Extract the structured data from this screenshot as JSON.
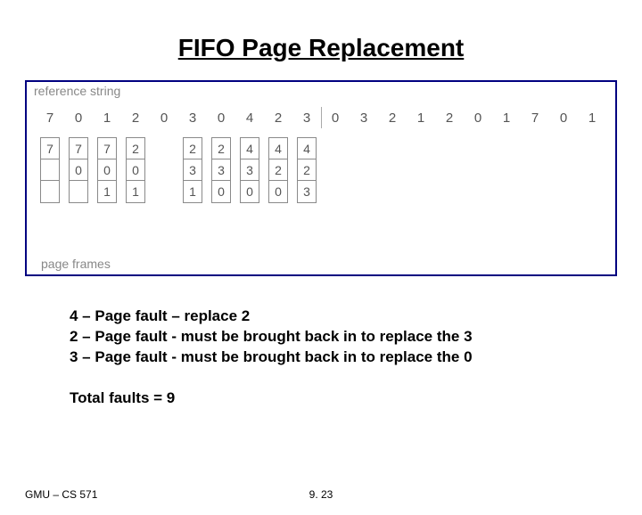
{
  "title": "FIFO Page Replacement",
  "diagram": {
    "ref_label": "reference string",
    "pf_label": "page frames",
    "reference": [
      "7",
      "0",
      "1",
      "2",
      "0",
      "3",
      "0",
      "4",
      "2",
      "3",
      "0",
      "3",
      "2",
      "1",
      "2",
      "0",
      "1",
      "7",
      "0",
      "1"
    ],
    "divider_after_index": 9,
    "frames": [
      [
        "7",
        "",
        ""
      ],
      [
        "7",
        "0",
        ""
      ],
      [
        "7",
        "0",
        "1"
      ],
      [
        "2",
        "0",
        "1"
      ],
      null,
      [
        "2",
        "3",
        "1"
      ],
      [
        "2",
        "3",
        "0"
      ],
      [
        "4",
        "3",
        "0"
      ],
      [
        "4",
        "2",
        "0"
      ],
      [
        "4",
        "2",
        "3"
      ],
      null,
      null,
      null,
      null,
      null,
      null,
      null,
      null,
      null,
      null
    ]
  },
  "notes": {
    "line1": "4 – Page fault – replace 2",
    "line2": "2 – Page fault - must be brought back in to replace the 3",
    "line3": "3 – Page fault - must be brought back in to replace the 0"
  },
  "total": "Total faults = 9",
  "footer": {
    "left": "GMU – CS 571",
    "center": "9. 23"
  }
}
